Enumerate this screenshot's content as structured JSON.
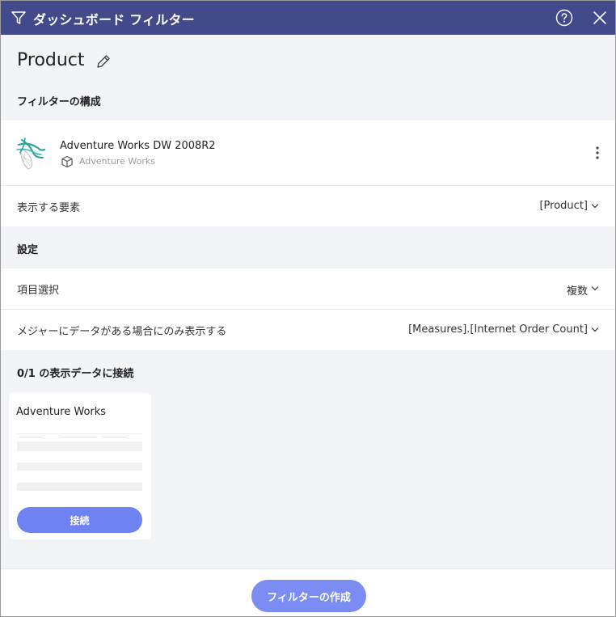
{
  "window": {
    "title": "ダッシュボード フィルター"
  },
  "header": {
    "page_title": "Product"
  },
  "sections": {
    "composition": "フィルターの構成",
    "settings": "設定",
    "connect": "0/1 の表示データに接続"
  },
  "datasource": {
    "name": "Adventure Works DW 2008R2",
    "sub": "Adventure Works"
  },
  "rows": {
    "display_element": {
      "label": "表示する要素",
      "value": "[Product]"
    },
    "item_selection": {
      "label": "項目選択",
      "value": "複数"
    },
    "measure_filter": {
      "label": "メジャーにデータがある場合にのみ表示する",
      "value": "[Measures].[Internet Order Count]"
    }
  },
  "card": {
    "title": "Adventure Works",
    "connect_label": "接続"
  },
  "footer": {
    "create_label": "フィルターの作成"
  },
  "colors": {
    "titlebar": "#424a8c",
    "accent": "#6e82f2",
    "background": "#f3f4f8"
  },
  "icons": {
    "titlebar": "filter-icon",
    "help": "help-icon",
    "close": "close-icon",
    "edit": "pencil-icon",
    "datasource": "sql-server-icon",
    "cube": "cube-icon",
    "more": "kebab-menu-icon",
    "dropdown": "chevron-down-icon"
  }
}
